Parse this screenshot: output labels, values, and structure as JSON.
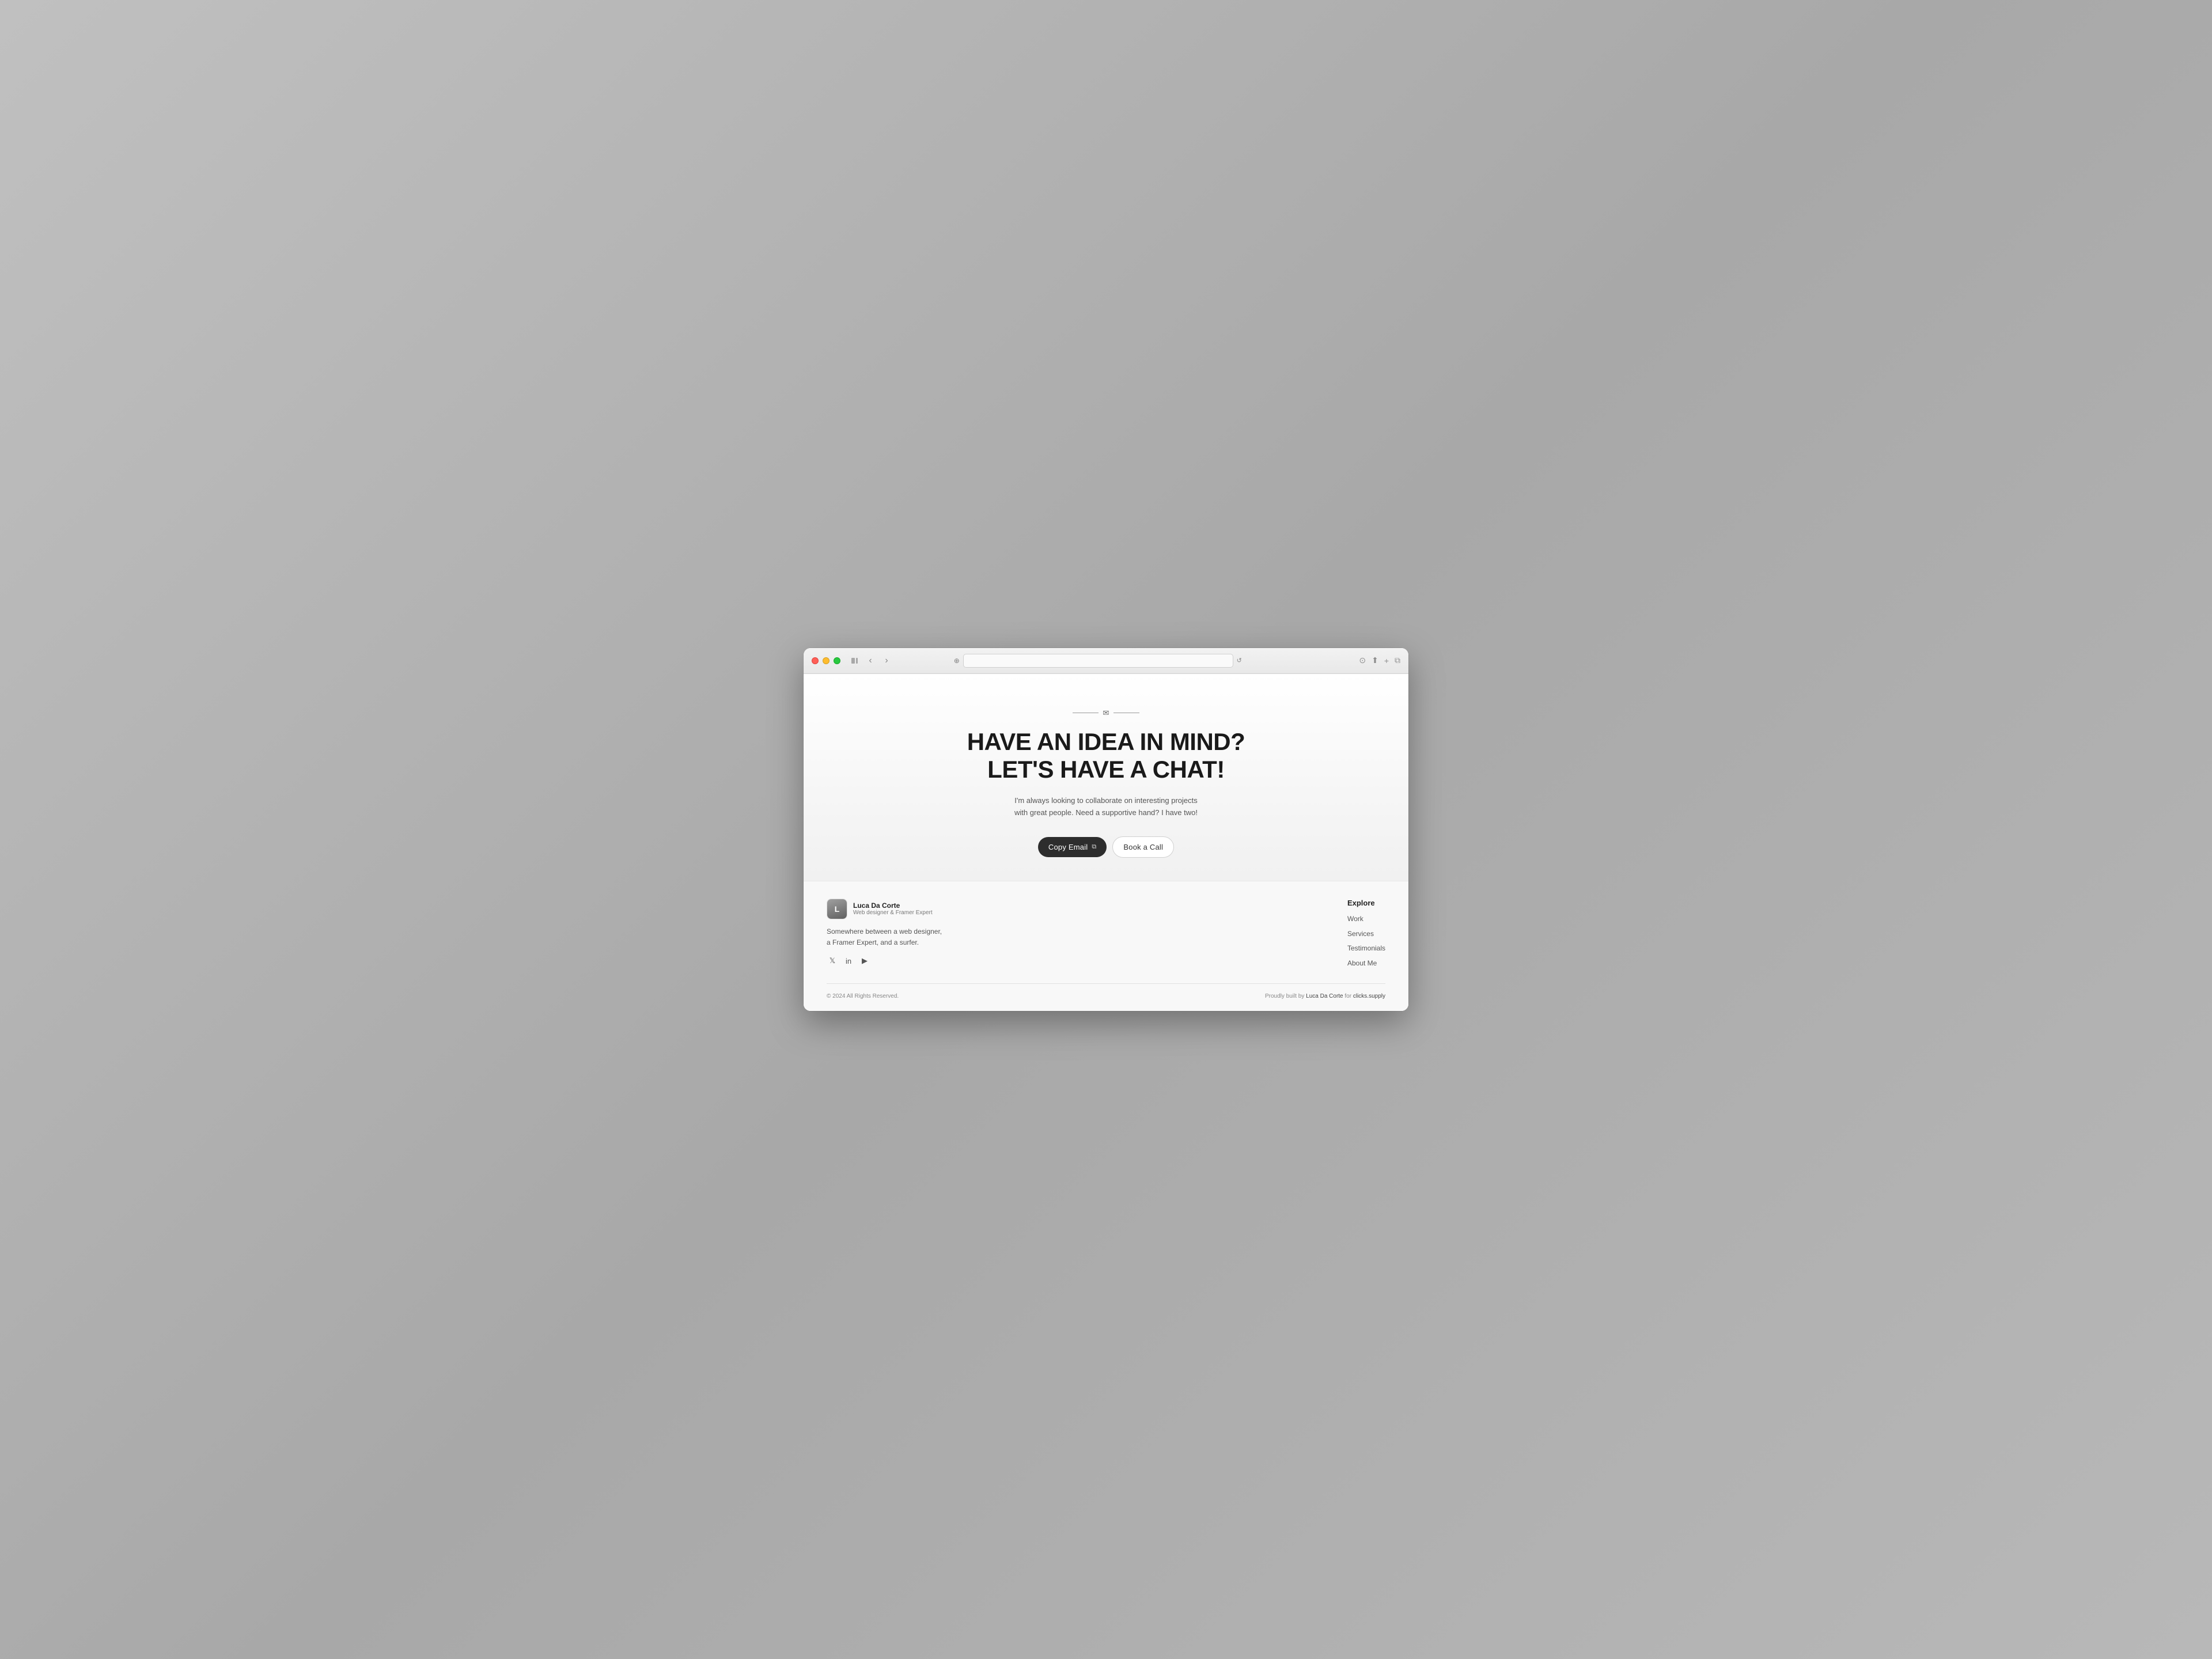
{
  "browser": {
    "address_bar_placeholder": "",
    "address_bar_value": ""
  },
  "hero": {
    "title_line1": "HAVE AN IDEA IN MIND?",
    "title_line2": "LET'S HAVE A CHAT!",
    "subtitle": "I'm always looking to collaborate on interesting projects with great people. Need a supportive hand? I have two!",
    "cta_copy_email": "Copy Email",
    "cta_book_call": "Book a Call"
  },
  "footer": {
    "author_name": "Luca Da Corte",
    "author_role": "Web designer & Framer Expert",
    "bio_line1": "Somewhere between a web designer,",
    "bio_line2": "a Framer Expert, and a surfer.",
    "explore_title": "Explore",
    "nav_links": [
      {
        "label": "Work",
        "href": "#"
      },
      {
        "label": "Services",
        "href": "#"
      },
      {
        "label": "Testimonials",
        "href": "#"
      },
      {
        "label": "About Me",
        "href": "#"
      }
    ],
    "copyright": "© 2024 All Rights Reserved.",
    "built_by_prefix": "Proudly built by ",
    "built_by_name": "Luca Da Corte",
    "built_by_middle": " for ",
    "built_by_site": "clicks.supply"
  }
}
